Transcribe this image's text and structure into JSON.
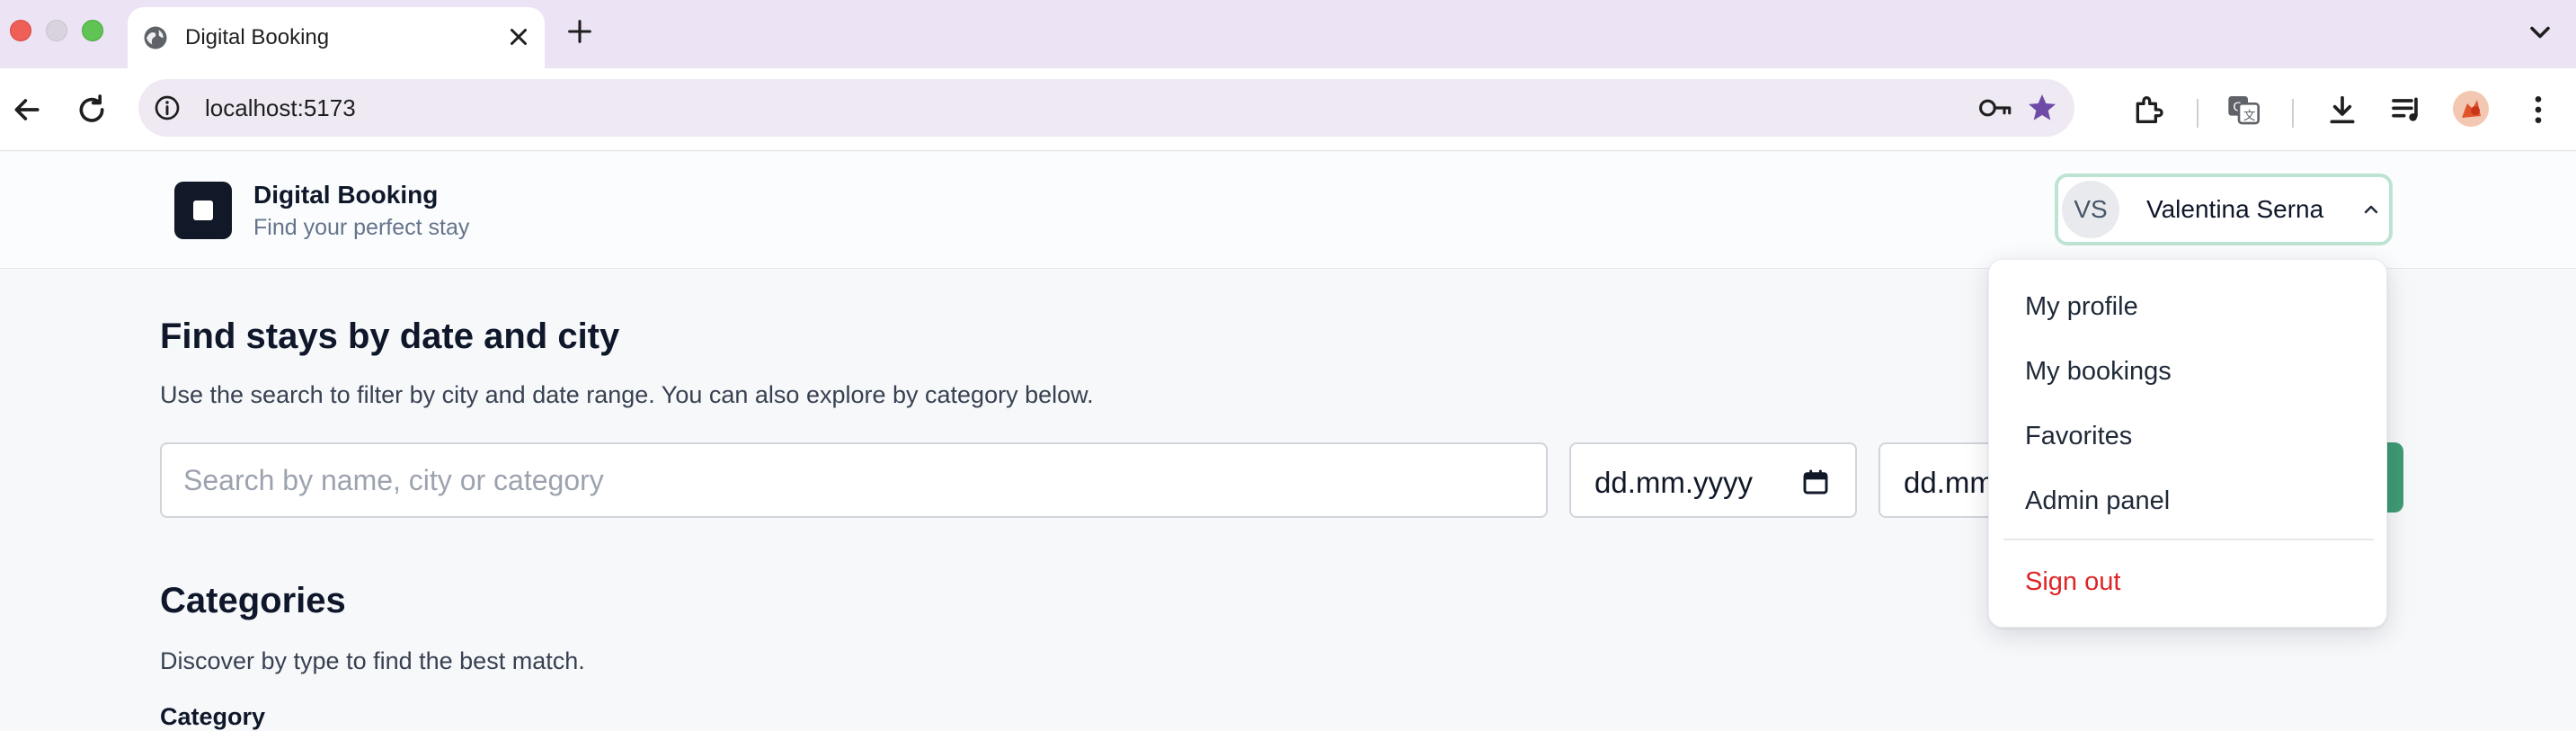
{
  "browser": {
    "tab_title": "Digital Booking",
    "url": "localhost:5173"
  },
  "header": {
    "brand_name": "Digital Booking",
    "brand_tagline": "Find your perfect stay",
    "user_initials": "VS",
    "user_name": "Valentina Serna"
  },
  "hero": {
    "title": "Find stays by date and city",
    "subtitle": "Use the search to filter by city and date range. You can also explore by category below.",
    "search_placeholder": "Search by name, city or category",
    "date_from": "dd.mm.yyyy",
    "date_to": "dd.mm"
  },
  "categories": {
    "title": "Categories",
    "subtitle": "Discover by type to find the best match.",
    "label": "Category"
  },
  "user_menu": {
    "items": [
      "My profile",
      "My bookings",
      "Favorites",
      "Admin panel"
    ],
    "sign_out": "Sign out"
  },
  "colors": {
    "accent": "#3f9b73",
    "danger": "#dc2626",
    "focus_ring": "#bfe3d3"
  }
}
